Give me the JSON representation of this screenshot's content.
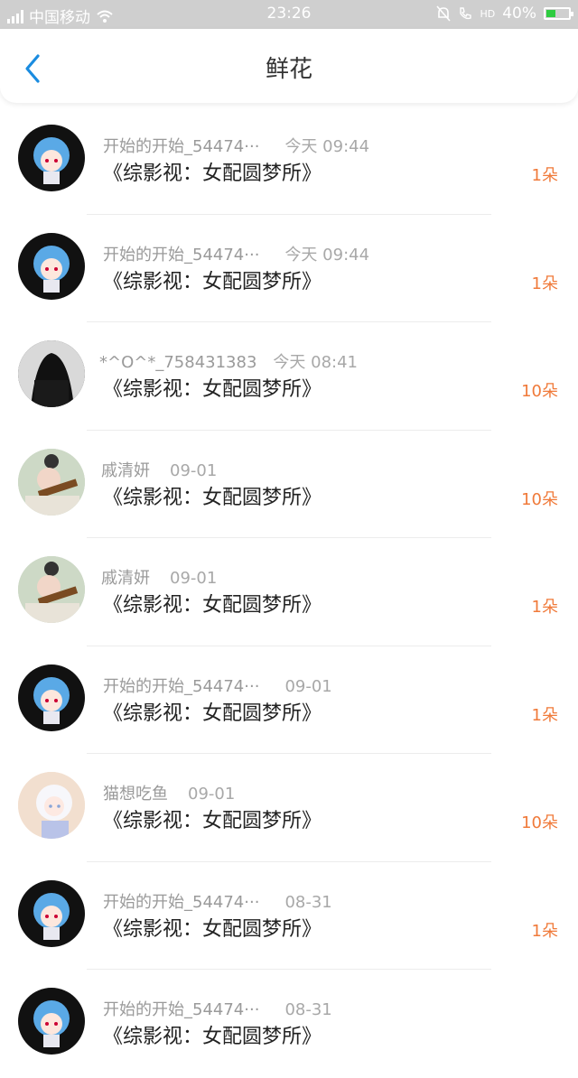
{
  "status_bar": {
    "carrier": "中国移动",
    "time": "23:26",
    "hd": "HD",
    "battery": "40%"
  },
  "nav": {
    "title": "鲜花"
  },
  "rows": [
    {
      "name": "开始的开始_54474···",
      "date": "今天 09:44",
      "book": "《综影视：女配圆梦所》",
      "count": "1朵",
      "avatar": "anime-girl-avatar"
    },
    {
      "name": "开始的开始_54474···",
      "date": "今天 09:44",
      "book": "《综影视：女配圆梦所》",
      "count": "1朵",
      "avatar": "anime-girl-avatar"
    },
    {
      "name": "*^O^*_758431383",
      "date": "今天 08:41",
      "book": "《综影视：女配圆梦所》",
      "count": "10朵",
      "avatar": "dark-haired-girl-avatar"
    },
    {
      "name": "戚清妍",
      "date": "09-01",
      "book": "《综影视：女配圆梦所》",
      "count": "10朵",
      "avatar": "violin-girl-avatar"
    },
    {
      "name": "戚清妍",
      "date": "09-01",
      "book": "《综影视：女配圆梦所》",
      "count": "1朵",
      "avatar": "violin-girl-avatar"
    },
    {
      "name": "开始的开始_54474···",
      "date": "09-01",
      "book": "《综影视：女配圆梦所》",
      "count": "1朵",
      "avatar": "anime-girl-avatar"
    },
    {
      "name": "猫想吃鱼",
      "date": "09-01",
      "book": "《综影视：女配圆梦所》",
      "count": "10朵",
      "avatar": "cat-girl-avatar"
    },
    {
      "name": "开始的开始_54474···",
      "date": "08-31",
      "book": "《综影视：女配圆梦所》",
      "count": "1朵",
      "avatar": "anime-girl-avatar"
    },
    {
      "name": "开始的开始_54474···",
      "date": "08-31",
      "book": "《综影视：女配圆梦所》",
      "count": "",
      "avatar": "anime-girl-avatar"
    }
  ],
  "colors": {
    "accent": "#1a8ce0",
    "count": "#f07a3a"
  }
}
